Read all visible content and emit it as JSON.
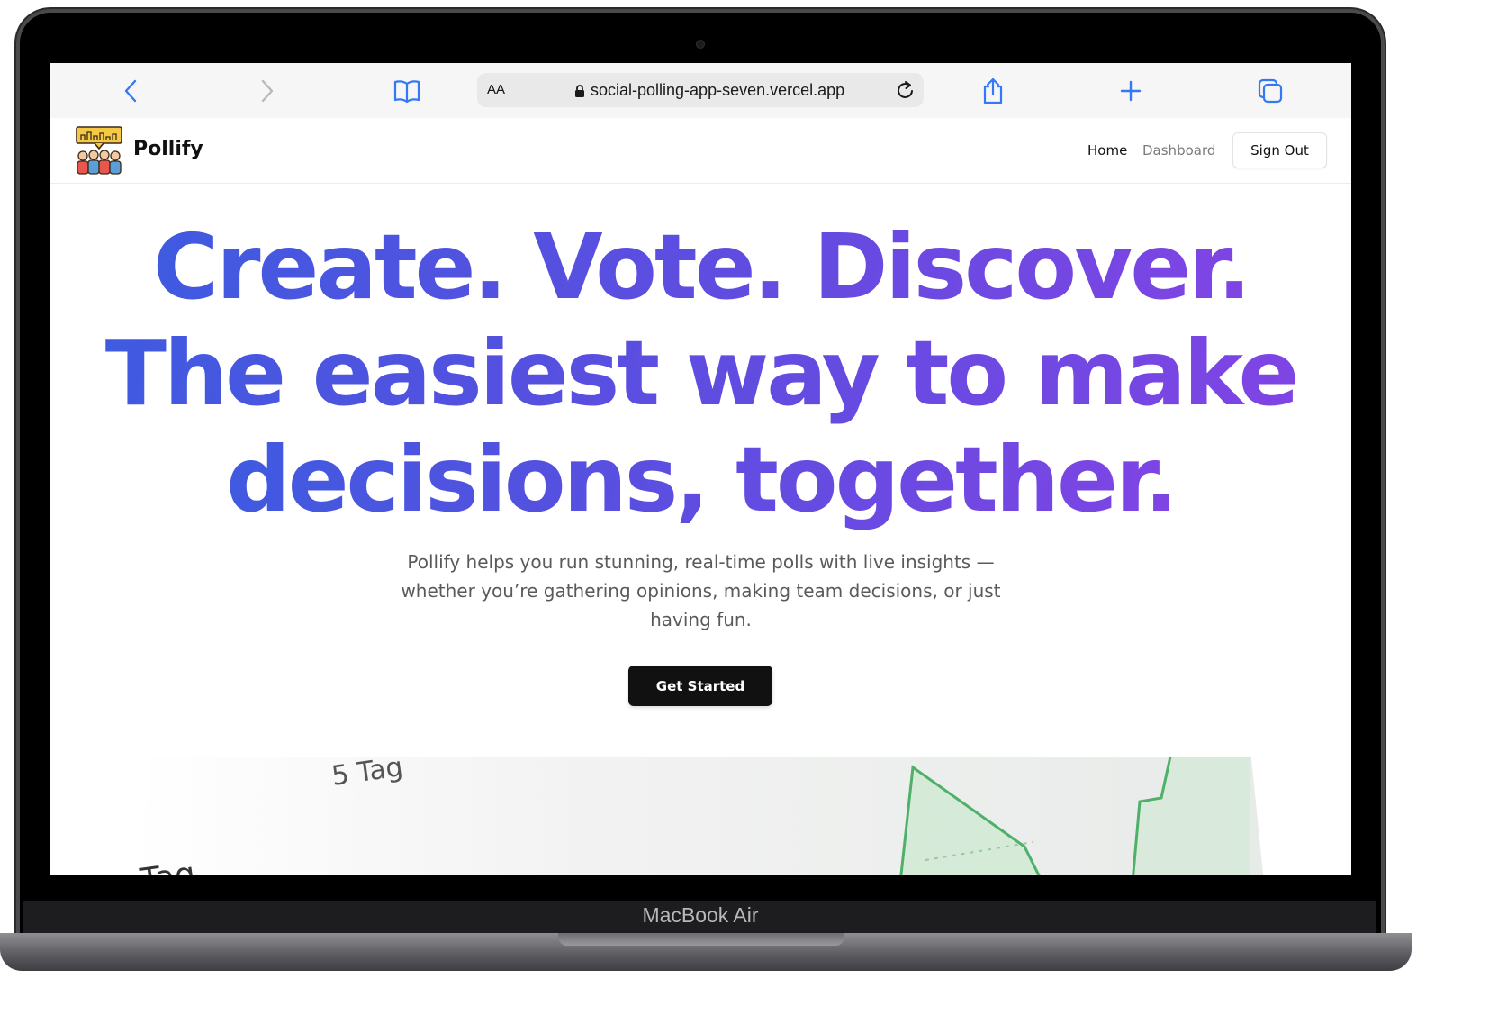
{
  "device": {
    "label": "MacBook Air"
  },
  "browser": {
    "text_size_label": "AA",
    "url": "social-polling-app-seven.vercel.app",
    "icons": {
      "back": "chevron-left-icon",
      "forward": "chevron-right-icon",
      "bookmarks": "book-icon",
      "lock": "lock-icon",
      "reload": "reload-icon",
      "share": "share-icon",
      "new_tab": "plus-icon",
      "tabs": "tabs-icon"
    },
    "accent_color": "#3478f6"
  },
  "app": {
    "brand": "Pollify",
    "nav": {
      "home": "Home",
      "dashboard": "Dashboard",
      "sign_out": "Sign Out"
    },
    "hero": {
      "line1": "Create. Vote. Discover.",
      "line2": "The easiest way to make",
      "line3": "decisions, together.",
      "subtitle": "Pollify helps you run stunning, real-time polls with live insights — whether you’re gathering opinions, making team decisions, or just having fun.",
      "cta": "Get Started",
      "gradient": [
        "#3f5ae0",
        "#7f44e4"
      ]
    },
    "preview": {
      "label_tag": "Tag",
      "label_5tag": "5 Tag"
    }
  }
}
